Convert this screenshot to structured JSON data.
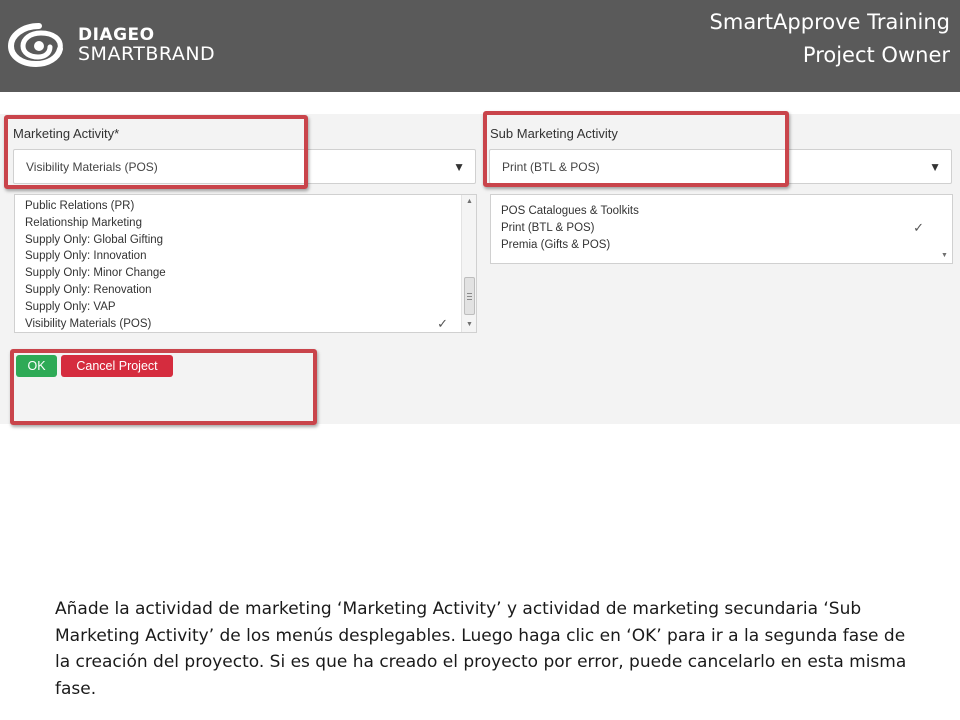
{
  "header": {
    "brand_top": "DIAGEO",
    "brand_bottom": "SMARTBRAND",
    "title_line1": "SmartApprove Training",
    "title_line2": "Project Owner"
  },
  "form": {
    "marketing_activity": {
      "label": "Marketing Activity*",
      "selected": "Visibility Materials (POS)",
      "options": [
        "Public Relations (PR)",
        "Relationship Marketing",
        "Supply Only: Global Gifting",
        "Supply Only: Innovation",
        "Supply Only: Minor Change",
        "Supply Only: Renovation",
        "Supply Only: VAP",
        "Visibility Materials (POS)"
      ]
    },
    "sub_marketing_activity": {
      "label": "Sub Marketing Activity",
      "selected": "Print (BTL & POS)",
      "options": [
        "POS Catalogues & Toolkits",
        "Print (BTL & POS)",
        "Premia (Gifts & POS)"
      ]
    },
    "check_mark": "✓",
    "ok_label": "OK",
    "cancel_label": "Cancel Project"
  },
  "caption": "Añade la actividad de marketing ‘Marketing Activity’ y actividad de marketing secundaria ‘Sub Marketing Activity’ de los menús desplegables.  Luego haga clic en ‘OK’ para ir a la segunda fase de la creación del proyecto.  Si es que ha creado el proyecto por error, puede cancelarlo en esta misma fase.",
  "icons": {
    "logo": "diageo-swirl-logo",
    "dropdown": "triangle-down-icon",
    "selected": "check-icon",
    "scroll_up": "scroll-up-icon",
    "scroll_down": "scroll-down-icon"
  },
  "colors": {
    "header_bg": "#5a5a5a",
    "form_bg": "#f3f3f3",
    "ok_button": "#2eaa56",
    "cancel_button": "#d52c3e",
    "highlight": "#c9444b"
  }
}
